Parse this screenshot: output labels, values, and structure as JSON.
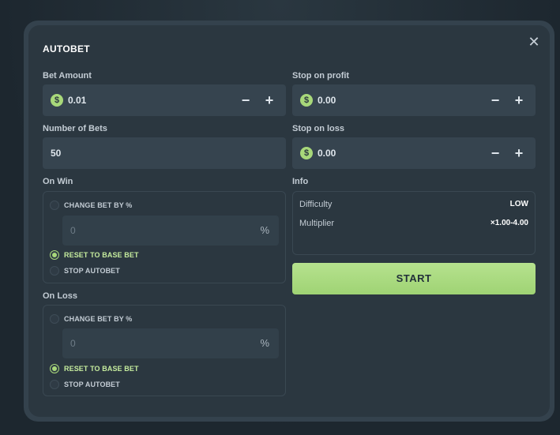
{
  "modal": {
    "title": "AUTOBET",
    "close_glyph": "✕"
  },
  "bet_amount": {
    "label": "Bet Amount",
    "value": "0.01",
    "currency_icon": "dollar-coin-icon"
  },
  "stop_on_profit": {
    "label": "Stop on profit",
    "value": "0.00",
    "currency_icon": "dollar-coin-icon"
  },
  "number_of_bets": {
    "label": "Number of Bets",
    "value": "50"
  },
  "stop_on_loss": {
    "label": "Stop on loss",
    "value": "0.00",
    "currency_icon": "dollar-coin-icon"
  },
  "stepper": {
    "minus": "−",
    "plus": "+"
  },
  "on_win": {
    "label": "On Win",
    "change_bet": "CHANGE BET BY %",
    "percent_value": "0",
    "percent_sign": "%",
    "reset": "RESET TO BASE BET",
    "stop": "STOP AUTOBET",
    "selected": "reset"
  },
  "on_loss": {
    "label": "On Loss",
    "change_bet": "CHANGE BET BY %",
    "percent_value": "0",
    "percent_sign": "%",
    "reset": "RESET TO BASE BET",
    "stop": "STOP AUTOBET",
    "selected": "reset"
  },
  "info": {
    "label": "Info",
    "difficulty_key": "Difficulty",
    "difficulty_value": "LOW",
    "multiplier_key": "Multiplier",
    "multiplier_value": "×1.00-4.00"
  },
  "start_button": {
    "label": "START"
  },
  "colors": {
    "accent": "#a8d87a",
    "modal_bg": "#2b3740",
    "field_bg": "#36444f"
  }
}
